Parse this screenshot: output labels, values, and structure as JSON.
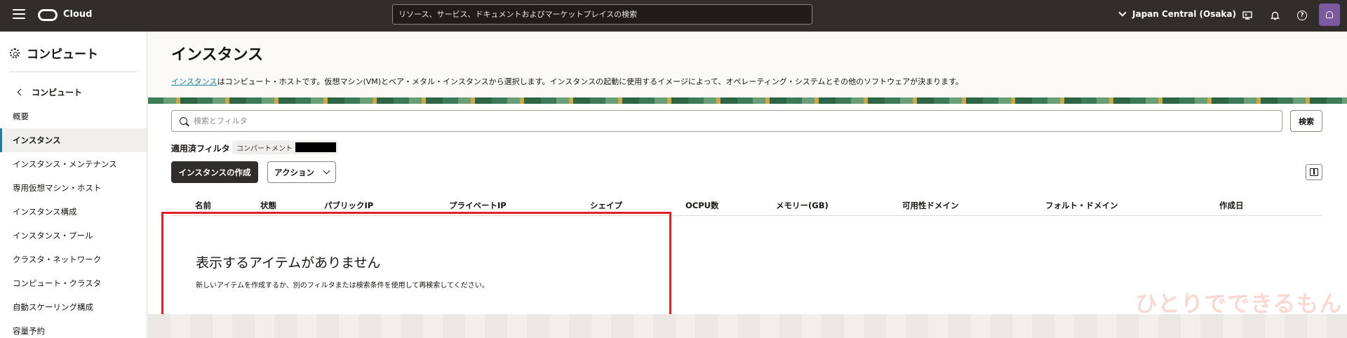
{
  "topbar": {
    "brand": "Cloud",
    "search_placeholder": "リソース、サービス、ドキュメントおよびマーケットプレイスの検索",
    "region": "Japan Central (Osaka)",
    "help_glyph": "?"
  },
  "sidebar": {
    "title": "コンピュート",
    "back_label": "コンピュート",
    "items": [
      {
        "label": "概要",
        "active": false
      },
      {
        "label": "インスタンス",
        "active": true
      },
      {
        "label": "インスタンス・メンテナンス",
        "active": false
      },
      {
        "label": "専用仮想マシン・ホスト",
        "active": false
      },
      {
        "label": "インスタンス構成",
        "active": false
      },
      {
        "label": "インスタンス・プール",
        "active": false
      },
      {
        "label": "クラスタ・ネットワーク",
        "active": false
      },
      {
        "label": "コンピュート・クラスタ",
        "active": false
      },
      {
        "label": "自動スケーリング構成",
        "active": false
      },
      {
        "label": "容量予約",
        "active": false
      }
    ]
  },
  "main": {
    "title": "インスタンス",
    "description_link": "インスタンス",
    "description_rest": "はコンピュート・ホストです。仮想マシン(VM)とベア・メタル・インスタンスから選択します。インスタンスの起動に使用するイメージによって、オペレーティング・システムとその他のソフトウェアが決まります。",
    "filter_placeholder": "検索とフィルタ",
    "search_button": "検索",
    "applied_filters_label": "適用済フィルタ",
    "compartment_chip": "コンパートメント",
    "create_button": "インスタンスの作成",
    "actions_button": "アクション",
    "columns": [
      "名前",
      "状態",
      "パブリックIP",
      "プライベートIP",
      "シェイプ",
      "OCPU数",
      "メモリー(GB)",
      "可用性ドメイン",
      "フォルト・ドメイン",
      "作成日"
    ],
    "empty_title": "表示するアイテムがありません",
    "empty_message": "新しいアイテムを作成するか、別のフィルタまたは検索条件を使用して再検索してください。"
  },
  "watermark": "ひとりでできるもん",
  "colors": {
    "header_bg": "#312d2a",
    "accent": "#227e9e",
    "highlight": "#e0212b",
    "avatar": "#7b5a9e"
  },
  "icons": [
    "menu-icon",
    "oracle-logo-icon",
    "chevron-down-icon",
    "cloud-shell-icon",
    "bell-icon",
    "help-icon",
    "user-icon",
    "gear-icon",
    "chevron-left-icon",
    "search-icon",
    "columns-icon"
  ]
}
